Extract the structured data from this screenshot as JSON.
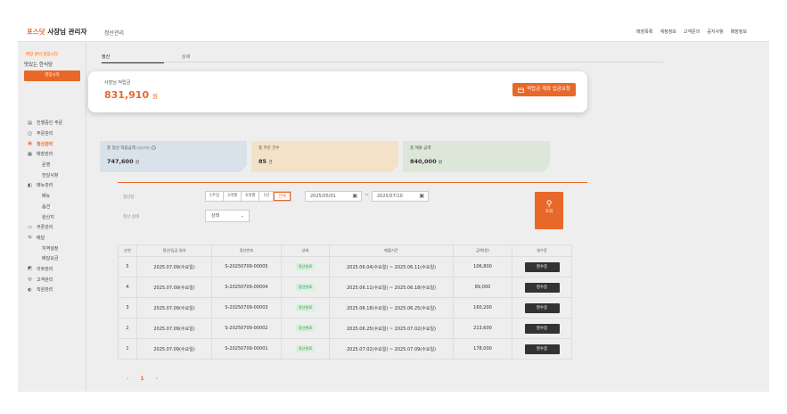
{
  "header": {
    "brand_mark": "포스닷",
    "brand_suffix": "사장님 관리자",
    "page_title": "정산관리",
    "nav": [
      "매장목록",
      "계정정보",
      "고객문의",
      "공지사항",
      "매장정보"
    ]
  },
  "sidebar": {
    "status_note": "매장 준비 중입니다",
    "store_name": "맛있는 한식당",
    "open_button": "영업시작",
    "menu": [
      {
        "label": "진행중인 주문",
        "icon": "receipt-icon",
        "sub": false,
        "active": false
      },
      {
        "label": "주문관리",
        "icon": "order-icon",
        "sub": false,
        "active": false
      },
      {
        "label": "정산관리",
        "icon": "settlement-icon",
        "sub": false,
        "active": true
      },
      {
        "label": "매장관리",
        "icon": "store-icon",
        "sub": false,
        "active": false
      },
      {
        "label": "운영",
        "icon": "",
        "sub": true,
        "active": false
      },
      {
        "label": "전달사항",
        "icon": "",
        "sub": true,
        "active": false
      },
      {
        "label": "메뉴관리",
        "icon": "menu-book-icon",
        "sub": false,
        "active": false
      },
      {
        "label": "메뉴",
        "icon": "",
        "sub": true,
        "active": false
      },
      {
        "label": "옵션",
        "icon": "",
        "sub": true,
        "active": false
      },
      {
        "label": "원산지",
        "icon": "",
        "sub": true,
        "active": false
      },
      {
        "label": "쿠폰관리",
        "icon": "coupon-icon",
        "sub": false,
        "active": false
      },
      {
        "label": "배달",
        "icon": "delivery-icon",
        "sub": false,
        "active": false
      },
      {
        "label": "지역설정",
        "icon": "",
        "sub": true,
        "active": false
      },
      {
        "label": "배달요금",
        "icon": "",
        "sub": true,
        "active": false
      },
      {
        "label": "리뷰관리",
        "icon": "review-icon",
        "sub": false,
        "active": false
      },
      {
        "label": "고객관리",
        "icon": "customer-icon",
        "sub": false,
        "active": false
      },
      {
        "label": "직원관리",
        "icon": "staff-icon",
        "sub": false,
        "active": false
      }
    ]
  },
  "tabs": {
    "settlement": "정산",
    "detail": "상세"
  },
  "balance": {
    "label": "사장님 적립금",
    "amount": "831,910",
    "unit": "원",
    "deposit_button": "적립금 계좌 입금요청"
  },
  "stats": [
    {
      "label": "총 정산 적립금액",
      "note": "(배정포함)",
      "value": "747,600",
      "unit": "원",
      "color": "#d9e2ea",
      "corner": "#a9b8c6"
    },
    {
      "label": "총 주문 건수",
      "note": "",
      "value": "85",
      "unit": "건",
      "color": "#f3e2c8",
      "corner": "#d9b98a"
    },
    {
      "label": "총 매출 금액",
      "note": "",
      "value": "840,000",
      "unit": "원",
      "color": "#dde7d9",
      "corner": "#aebfa6"
    }
  ],
  "filters": {
    "period_label": "정산일",
    "periods": [
      "1주일",
      "3개월",
      "6개월",
      "1년",
      "전체"
    ],
    "selected_period": "전체",
    "date_from": "2025/05/01",
    "tilde": "~",
    "date_to": "2025/07/10",
    "status_label": "정산 상태",
    "status_value": "상태",
    "search_button": "조회"
  },
  "table": {
    "headers": [
      "순번",
      "정산/입금 일자",
      "정산번호",
      "상태",
      "매출기간",
      "금액(원)",
      "영수증"
    ],
    "rows": [
      {
        "no": "5",
        "date": "2025.07.09(수요일)",
        "id": "S-20250709-00005",
        "status": "정산완료",
        "period": "2025.06.04(수요일) ~ 2025.06.11(수요일)",
        "amount": "106,800",
        "receipt": "영수증"
      },
      {
        "no": "4",
        "date": "2025.07.09(수요일)",
        "id": "S-20250709-00004",
        "status": "정산완료",
        "period": "2025.06.11(수요일) ~ 2025.06.18(수요일)",
        "amount": "89,000",
        "receipt": "영수증"
      },
      {
        "no": "3",
        "date": "2025.07.09(수요일)",
        "id": "S-20250709-00003",
        "status": "정산완료",
        "period": "2025.06.18(수요일) ~ 2025.06.25(수요일)",
        "amount": "160,200",
        "receipt": "영수증"
      },
      {
        "no": "2",
        "date": "2025.07.09(수요일)",
        "id": "S-20250709-00002",
        "status": "정산완료",
        "period": "2025.06.25(수요일) ~ 2025.07.02(수요일)",
        "amount": "213,600",
        "receipt": "영수증"
      },
      {
        "no": "1",
        "date": "2025.07.09(수요일)",
        "id": "S-20250709-00001",
        "status": "정산완료",
        "period": "2025.07.02(수요일) ~ 2025.07.09(수요일)",
        "amount": "178,000",
        "receipt": "영수증"
      }
    ]
  },
  "pagination": {
    "prev": "‹",
    "current": "1",
    "next": "›"
  }
}
